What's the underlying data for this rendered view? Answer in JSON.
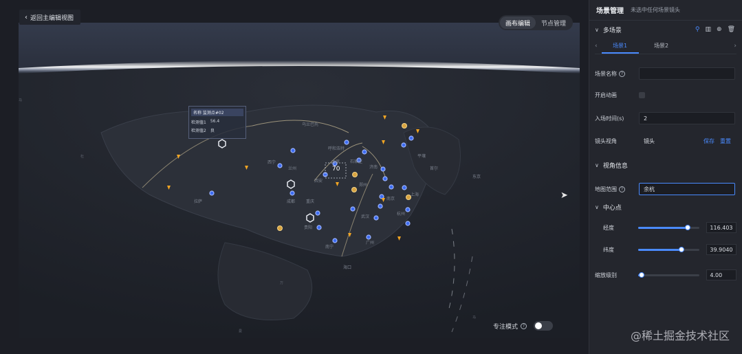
{
  "canvas": {
    "back_label": "返回主编辑视图",
    "back_icon": "chevron-left-icon",
    "mode_tabs": [
      {
        "label": "画布编辑",
        "active": true
      },
      {
        "label": "节点管理",
        "active": false
      }
    ],
    "focus_mode_label": "专注模式",
    "focus_mode_on": false
  },
  "map": {
    "tooltip": {
      "title": "名称 监测点#02",
      "rows": [
        {
          "label": "检测值1",
          "value": "56.4"
        },
        {
          "label": "检测值2",
          "value": "良"
        }
      ]
    },
    "cluster_count": "70",
    "place_labels": [
      "乌兰巴托",
      "呼和浩特",
      "太原",
      "石家庄",
      "济南",
      "郑州",
      "西安",
      "武汉",
      "南京",
      "上海",
      "杭州",
      "重庆",
      "成都",
      "贵阳",
      "广州",
      "南宁",
      "海口",
      "西宁",
      "兰州",
      "拉萨",
      "平壤",
      "首尔",
      "东京"
    ],
    "colors": {
      "node_blue": "#3d6cf2",
      "node_orange": "#f5a623",
      "globe_glow": "#ffffff"
    }
  },
  "panel": {
    "title": "场景管理",
    "subtitle": "未选中任何场景镜头",
    "multi_scene": {
      "title": "多场景",
      "icons": [
        "filter-icon",
        "columns-icon",
        "add-circle-icon",
        "delete-icon"
      ],
      "tabs": [
        {
          "label": "场景1",
          "active": true
        },
        {
          "label": "场景2",
          "active": false
        }
      ]
    },
    "scene_name_label": "场景名称",
    "scene_name_value": "",
    "animate_label": "开启动画",
    "animate_checked": false,
    "enter_time_label": "入场时间(s)",
    "enter_time_value": "2",
    "camera_label": "镜头视角",
    "camera_value": "镜头",
    "save_label": "保存",
    "reset_label": "重置",
    "view_info_title": "视角信息",
    "map_range_label": "地图范围",
    "map_range_value": "余杭",
    "center_title": "中心点",
    "longitude_label": "经度",
    "longitude_value": "116.403",
    "longitude_fraction": 0.8,
    "latitude_label": "纬度",
    "latitude_value": "39.9040",
    "latitude_fraction": 0.7,
    "zoom_label": "缩放级别",
    "zoom_value": "4.00",
    "zoom_fraction": 0.05
  },
  "watermark": "@稀土掘金技术社区"
}
